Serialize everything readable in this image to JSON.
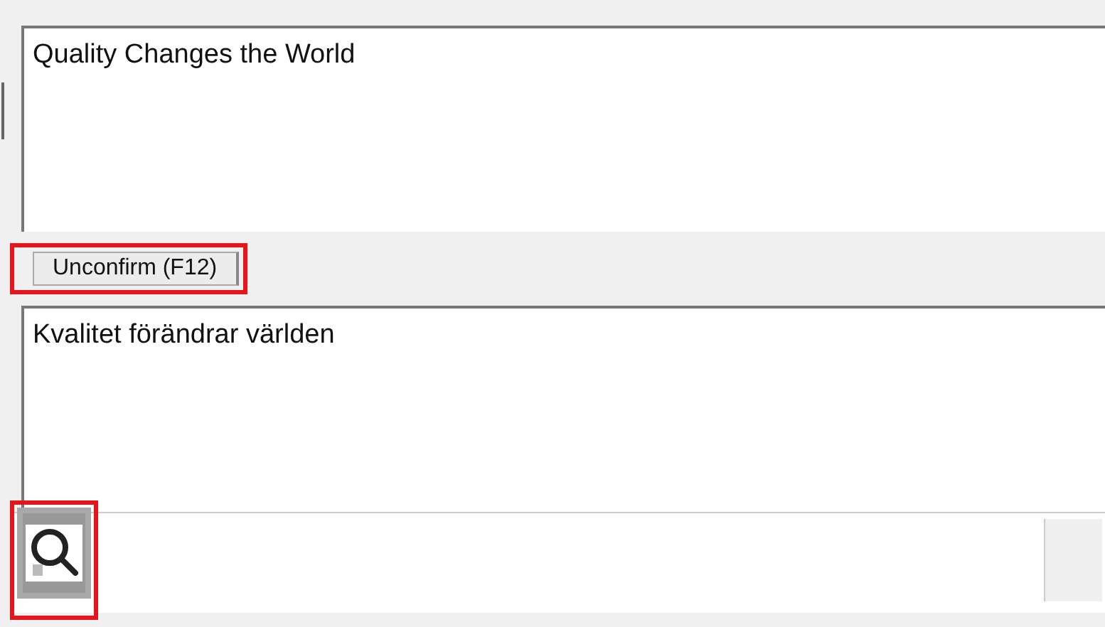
{
  "source_text": {
    "value": "Quality Changes the World"
  },
  "confirm_button": {
    "label": "Unconfirm (F12)",
    "highlighted": true
  },
  "target_text": {
    "value": "Kvalitet förändrar världen"
  },
  "search_button": {
    "highlighted": true
  }
}
